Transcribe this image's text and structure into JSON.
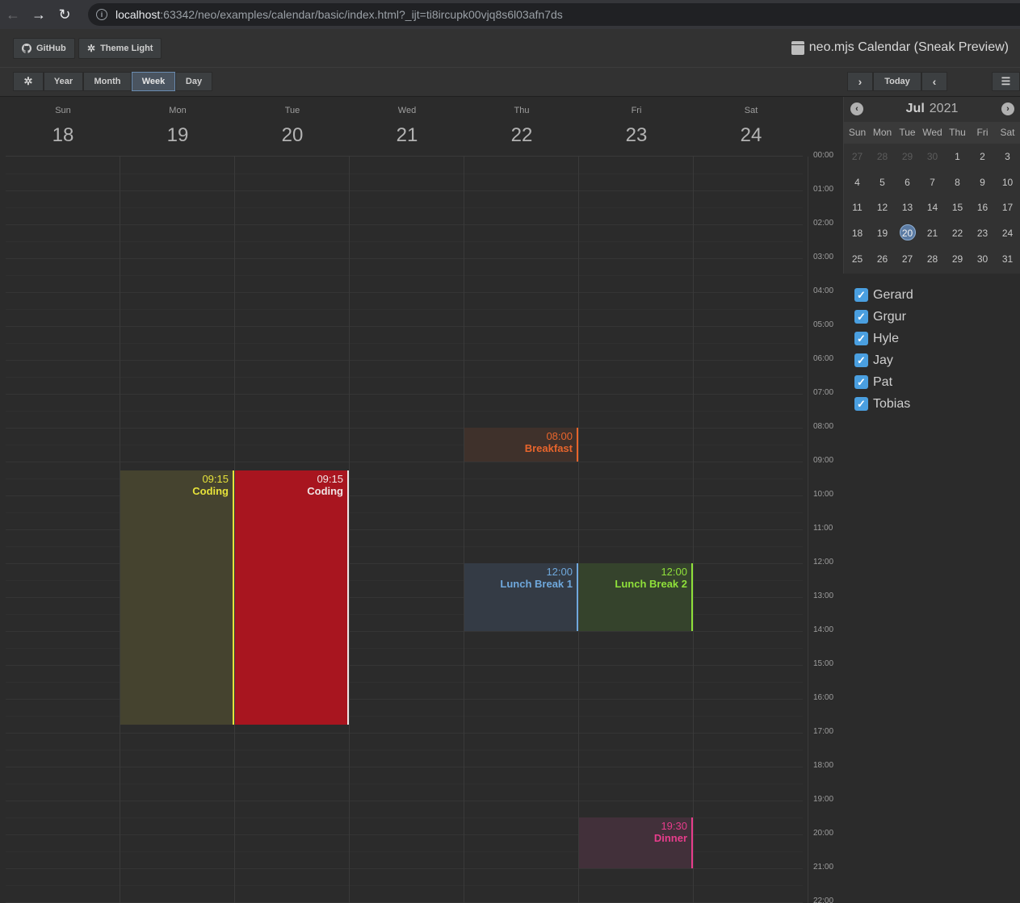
{
  "browser": {
    "back_icon": "←",
    "forward_icon": "→",
    "reload_icon": "↻",
    "url_host": "localhost",
    "url_rest": ":63342/neo/examples/calendar/basic/index.html?_ijt=ti8ircupk00vjq8s6l03afn7ds"
  },
  "header": {
    "github_label": "GitHub",
    "theme_label": "Theme Light",
    "title": "neo.mjs Calendar (Sneak Preview)"
  },
  "toolbar": {
    "views": [
      "Year",
      "Month",
      "Week",
      "Day"
    ],
    "active_view": "Week",
    "today_label": "Today"
  },
  "week": {
    "days": [
      {
        "name": "Sun",
        "num": "18"
      },
      {
        "name": "Mon",
        "num": "19"
      },
      {
        "name": "Tue",
        "num": "20"
      },
      {
        "name": "Wed",
        "num": "21"
      },
      {
        "name": "Thu",
        "num": "22"
      },
      {
        "name": "Fri",
        "num": "23"
      },
      {
        "name": "Sat",
        "num": "24"
      }
    ],
    "times": [
      "00:00",
      "01:00",
      "02:00",
      "03:00",
      "04:00",
      "05:00",
      "06:00",
      "07:00",
      "08:00",
      "09:00",
      "10:00",
      "11:00",
      "12:00",
      "13:00",
      "14:00",
      "15:00",
      "16:00",
      "17:00",
      "18:00",
      "19:00",
      "20:00",
      "21:00",
      "22:00"
    ],
    "events": [
      {
        "title": "Breakfast",
        "time": "08:00",
        "color": "#e8652c",
        "bg": "#3f312b"
      },
      {
        "title": "Coding",
        "time": "09:15",
        "color": "#e6e23a",
        "bg": "#45432f"
      },
      {
        "title": "Coding",
        "time": "09:15",
        "color": "#f0e4e4",
        "bg": "#a8151f"
      },
      {
        "title": "Lunch Break 1",
        "time": "12:00",
        "color": "#6fa8dc",
        "bg": "#343b45"
      },
      {
        "title": "Lunch Break 2",
        "time": "12:00",
        "color": "#8fe03a",
        "bg": "#35432c"
      },
      {
        "title": "Dinner",
        "time": "19:30",
        "color": "#e83d8c",
        "bg": "#42303a"
      }
    ]
  },
  "datepicker": {
    "month": "Jul",
    "year": "2021",
    "weekdays": [
      "Sun",
      "Mon",
      "Tue",
      "Wed",
      "Thu",
      "Fri",
      "Sat"
    ],
    "rows": [
      [
        "27",
        "28",
        "29",
        "30",
        "1",
        "2",
        "3"
      ],
      [
        "4",
        "5",
        "6",
        "7",
        "8",
        "9",
        "10"
      ],
      [
        "11",
        "12",
        "13",
        "14",
        "15",
        "16",
        "17"
      ],
      [
        "18",
        "19",
        "20",
        "21",
        "22",
        "23",
        "24"
      ],
      [
        "25",
        "26",
        "27",
        "28",
        "29",
        "30",
        "31"
      ]
    ],
    "today": "20"
  },
  "calendars": [
    "Gerard",
    "Grgur",
    "Hyle",
    "Jay",
    "Pat",
    "Tobias"
  ]
}
